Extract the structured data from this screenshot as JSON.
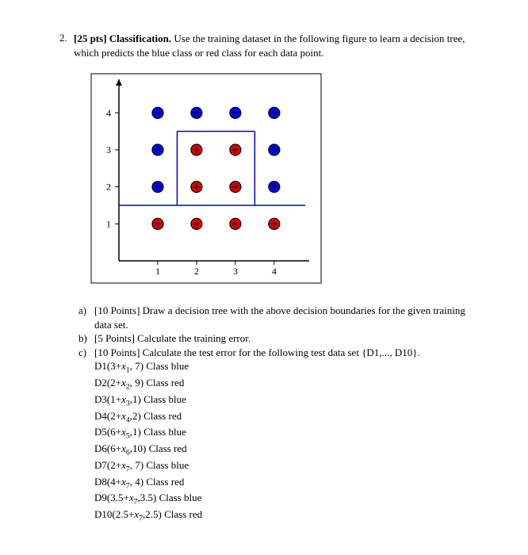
{
  "question": {
    "number": "2.",
    "points_label": "[25 pts] Classification.",
    "intro": " Use the training dataset in the following figure to learn a decision tree, which predicts the blue class or red class for each data point."
  },
  "chart_data": {
    "type": "scatter",
    "xlabel": "",
    "ylabel": "",
    "xlim": [
      0,
      4.8
    ],
    "ylim": [
      0,
      4.8
    ],
    "xticks": [
      1,
      2,
      3,
      4
    ],
    "yticks": [
      1,
      2,
      3,
      4
    ],
    "series": [
      {
        "name": "blue",
        "color": "#0000ff",
        "points": [
          {
            "x": 1,
            "y": 4
          },
          {
            "x": 2,
            "y": 4
          },
          {
            "x": 3,
            "y": 4
          },
          {
            "x": 4,
            "y": 4
          },
          {
            "x": 1,
            "y": 3
          },
          {
            "x": 4,
            "y": 3
          },
          {
            "x": 1,
            "y": 2
          },
          {
            "x": 4,
            "y": 2
          }
        ]
      },
      {
        "name": "red",
        "color": "#e00000",
        "points": [
          {
            "x": 2,
            "y": 3
          },
          {
            "x": 3,
            "y": 3
          },
          {
            "x": 2,
            "y": 2
          },
          {
            "x": 3,
            "y": 2
          },
          {
            "x": 1,
            "y": 1
          },
          {
            "x": 2,
            "y": 1
          },
          {
            "x": 3,
            "y": 1
          },
          {
            "x": 4,
            "y": 1
          }
        ]
      }
    ],
    "decision_lines": [
      {
        "x1": 0,
        "y1": 1.5,
        "x2": 4.8,
        "y2": 1.5
      },
      {
        "x1": 1.5,
        "y1": 1.5,
        "x2": 1.5,
        "y2": 3.5
      },
      {
        "x1": 3.5,
        "y1": 1.5,
        "x2": 3.5,
        "y2": 3.5
      },
      {
        "x1": 1.5,
        "y1": 3.5,
        "x2": 3.5,
        "y2": 3.5
      }
    ]
  },
  "parts": {
    "a": {
      "letter": "a)",
      "pts": "[10 Points]",
      "text": " Draw a decision tree with the above decision boundaries for the given training data set."
    },
    "b": {
      "letter": "b)",
      "pts": "[5 Points]",
      "text": " Calculate the training error."
    },
    "c": {
      "letter": "c)",
      "pts": "[10 Points]",
      "text": " Calculate the test error for the following test data set {D1,..., D10}."
    }
  },
  "test_data": [
    {
      "name": "D1",
      "pre": "(3+",
      "var": "x",
      "sub": "1",
      "post": ", 7)",
      "cls": "Class blue"
    },
    {
      "name": "D2",
      "pre": "(2+",
      "var": "x",
      "sub": "2",
      "post": ", 9)",
      "cls": "Class red"
    },
    {
      "name": "D3",
      "pre": "(1+",
      "var": "x",
      "sub": "3",
      "post": ",1)",
      "cls": "Class blue"
    },
    {
      "name": "D4",
      "pre": "(2+",
      "var": "x",
      "sub": "4",
      "post": ",2)",
      "cls": "Class red"
    },
    {
      "name": "D5",
      "pre": "(6+",
      "var": "x",
      "sub": "5",
      "post": ",1)",
      "cls": "Class blue"
    },
    {
      "name": "D6",
      "pre": "(6+",
      "var": "x",
      "sub": "6",
      "post": ",10)",
      "cls": "Class red"
    },
    {
      "name": "D7",
      "pre": "(2+",
      "var": "x",
      "sub": "7",
      "post": ", 7)",
      "cls": "Class blue"
    },
    {
      "name": "D8",
      "pre": "(4+",
      "var": "x",
      "sub": "7",
      "post": ", 4)",
      "cls": "Class red"
    },
    {
      "name": "D9",
      "pre": "(3.5+",
      "var": "x",
      "sub": "7",
      "post": ",3.5)",
      "cls": "Class blue"
    },
    {
      "name": "D10",
      "pre": "(2.5+",
      "var": "x",
      "sub": "7",
      "post": ",2.5)",
      "cls": "Class red"
    }
  ]
}
